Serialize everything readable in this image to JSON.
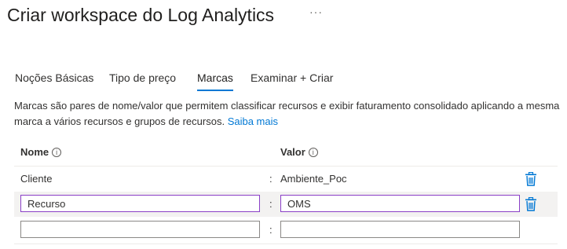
{
  "page": {
    "title": "Criar workspace do Log Analytics",
    "more_label": "···"
  },
  "tabs": [
    {
      "label": "Noções Básicas",
      "active": false
    },
    {
      "label": "Tipo de preço",
      "active": false
    },
    {
      "label": "Marcas",
      "active": true
    },
    {
      "label": "Examinar + Criar",
      "active": false
    }
  ],
  "description": {
    "text": "Marcas são pares de nome/valor que permitem classificar recursos e exibir faturamento consolidado aplicando a mesma marca a vários recursos e grupos de recursos.",
    "link": "Saiba mais"
  },
  "table": {
    "name_header": "Nome",
    "value_header": "Valor",
    "info_glyph": "i",
    "separator": ":",
    "rows": [
      {
        "name": "Cliente",
        "value": "Ambiente_Poc",
        "editable": false
      },
      {
        "name": "Recurso",
        "value": "OMS",
        "editable": true
      },
      {
        "name": "",
        "value": "",
        "editable": true
      }
    ]
  },
  "icons": {
    "delete": "trash-icon",
    "info": "info-icon",
    "more": "more-icon"
  },
  "colors": {
    "accent": "#0078d4",
    "focus_border": "#8a3fc7",
    "row_highlight": "#f3f2f1"
  }
}
